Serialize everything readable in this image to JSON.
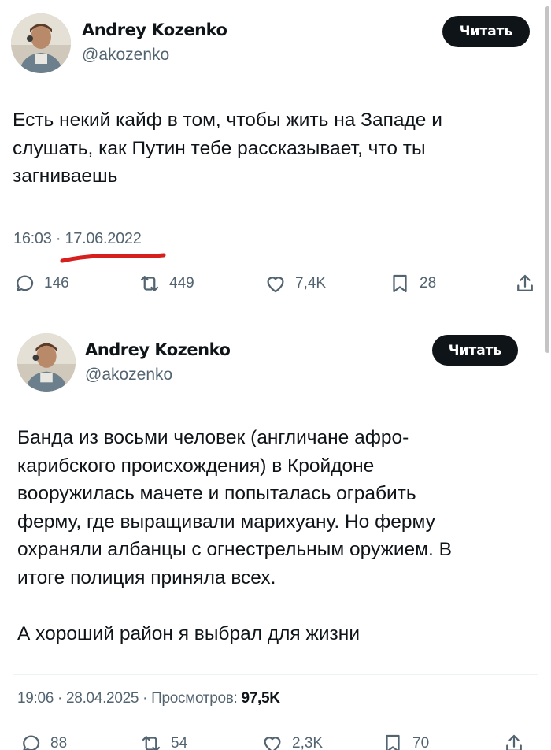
{
  "tweets": [
    {
      "author_name": "Andrey Kozenko",
      "handle": "@akozenko",
      "follow_label": "Читать",
      "text_lines": [
        "Есть некий кайф в том, чтобы жить на Западе и",
        "слушать, как Путин тебе рассказывает, что ты",
        "загниваешь"
      ],
      "time": "16:03",
      "sep": " · ",
      "date": "17.06.2022",
      "replies": "146",
      "reposts": "449",
      "likes": "7,4K",
      "bookmarks": "28"
    },
    {
      "author_name": "Andrey Kozenko",
      "handle": "@akozenko",
      "follow_label": "Читать",
      "text_lines": [
        "Банда из восьми человек (англичане афро-",
        "карибского происхождения) в Кройдоне",
        "вооружилась мачете и попыталась ограбить",
        "ферму, где выращивали марихуану. Но ферму",
        "охраняли албанцы с огнестрельным оружием. В",
        "итоге полиция приняла всех.",
        "",
        "А хороший район я выбрал для жизни"
      ],
      "meta_prefix": "19:06 · 28.04.2025 · Просмотров: ",
      "views": "97,5K",
      "replies": "88",
      "reposts": "54",
      "likes": "2,3K",
      "bookmarks": "70"
    }
  ],
  "colors": {
    "text": "#0f1419",
    "secondary": "#536471",
    "button_bg": "#0f1419",
    "underline_annotation": "#d61f1f"
  },
  "icons": [
    "reply-icon",
    "repost-icon",
    "like-icon",
    "bookmark-icon",
    "share-icon"
  ]
}
